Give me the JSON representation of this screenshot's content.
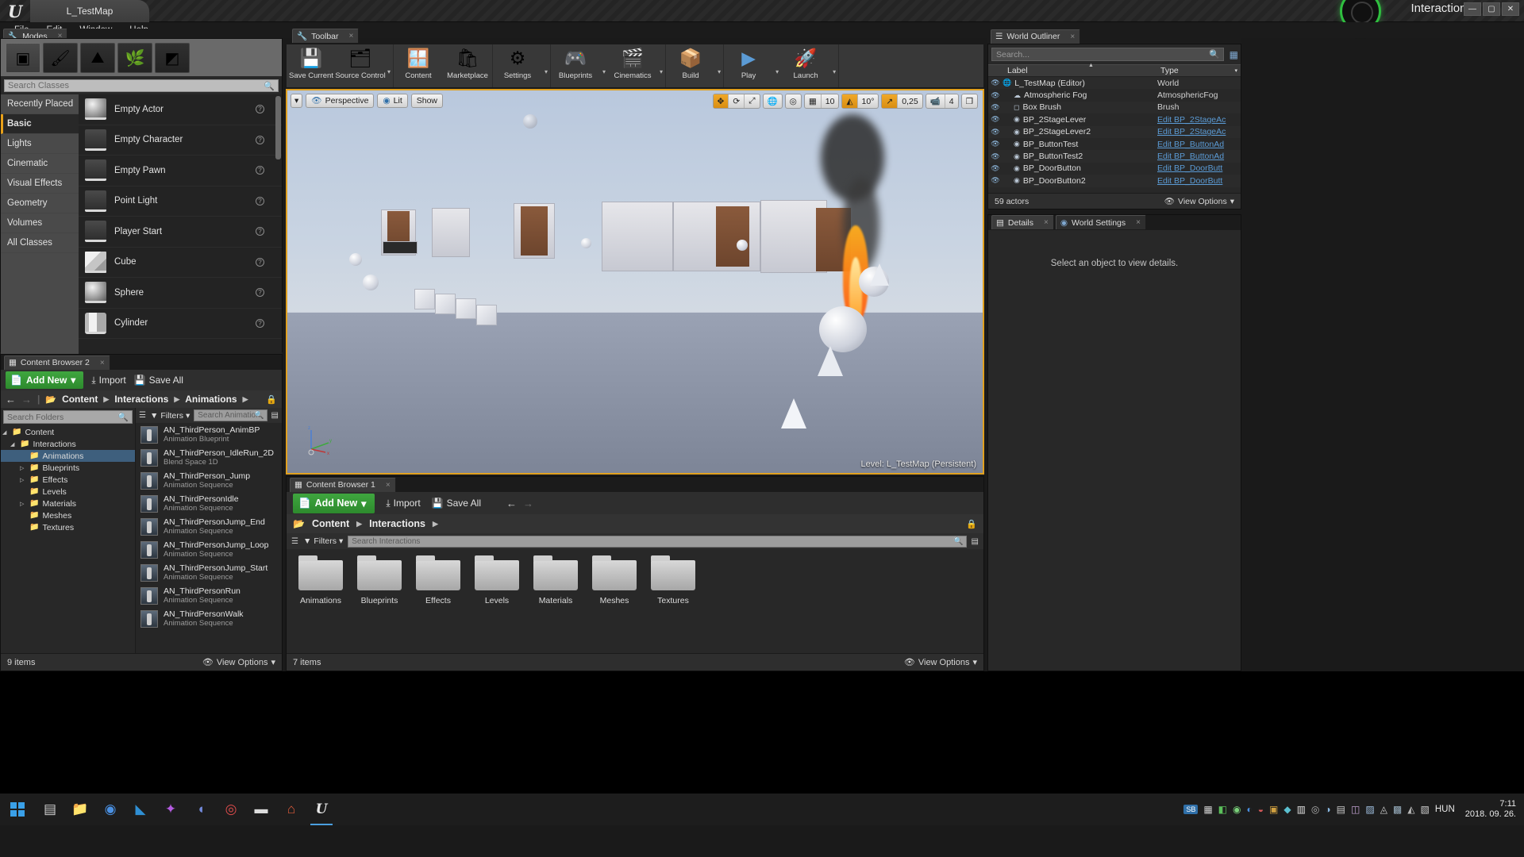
{
  "window": {
    "map_tab": "L_TestMap",
    "project_name": "Interactions",
    "minimize": "—",
    "maximize": "▢",
    "close": "✕"
  },
  "menu": {
    "items": [
      "File",
      "Edit",
      "Window",
      "Help"
    ]
  },
  "modes": {
    "tab": "Modes",
    "tab_close": "×",
    "mode_buttons": [
      {
        "name": "place-mode",
        "glyph": "▣"
      },
      {
        "name": "paint-mode",
        "glyph": "🖌"
      },
      {
        "name": "landscape-mode",
        "glyph": "⛰"
      },
      {
        "name": "foliage-mode",
        "glyph": "🌿"
      },
      {
        "name": "geometry-editing-mode",
        "glyph": "◩"
      }
    ],
    "search_placeholder": "Search Classes",
    "categories": [
      "Recently Placed",
      "Basic",
      "Lights",
      "Cinematic",
      "Visual Effects",
      "Geometry",
      "Volumes",
      "All Classes"
    ],
    "active_category": "Basic",
    "assets": [
      {
        "name": "Empty Actor",
        "thumb": "sphere"
      },
      {
        "name": "Empty Character",
        "thumb": "dark"
      },
      {
        "name": "Empty Pawn",
        "thumb": "dark"
      },
      {
        "name": "Point Light",
        "thumb": "dark"
      },
      {
        "name": "Player Start",
        "thumb": "dark"
      },
      {
        "name": "Cube",
        "thumb": "cube"
      },
      {
        "name": "Sphere",
        "thumb": "sphere"
      },
      {
        "name": "Cylinder",
        "thumb": "cyl"
      }
    ],
    "help_glyph": "?"
  },
  "toolbar": {
    "tab": "Toolbar",
    "tab_close": "×",
    "items": [
      {
        "label": "Save Current",
        "icon": "save-icon",
        "glyph": "💾",
        "caret": false
      },
      {
        "label": "Source Control",
        "icon": "source-control-icon",
        "glyph": "🗂",
        "caret": true
      },
      {
        "label": "Content",
        "icon": "content-icon",
        "glyph": "🪟",
        "caret": false
      },
      {
        "label": "Marketplace",
        "icon": "marketplace-icon",
        "glyph": "🛍",
        "caret": false
      },
      {
        "label": "Settings",
        "icon": "settings-icon",
        "glyph": "⚙",
        "caret": true
      },
      {
        "label": "Blueprints",
        "icon": "blueprints-icon",
        "glyph": "🎮",
        "caret": true
      },
      {
        "label": "Cinematics",
        "icon": "cinematics-icon",
        "glyph": "🎬",
        "caret": true
      },
      {
        "label": "Build",
        "icon": "build-icon",
        "glyph": "📦",
        "caret": true
      },
      {
        "label": "Play",
        "icon": "play-icon",
        "glyph": "▶",
        "caret": true
      },
      {
        "label": "Launch",
        "icon": "launch-icon",
        "glyph": "🚀",
        "caret": true
      }
    ]
  },
  "viewport": {
    "menu_caret": "▾",
    "perspective": "Perspective",
    "perspective_icon": "eye-icon",
    "lit": "Lit",
    "show": "Show",
    "transform_tools": [
      "✥",
      "⟳",
      "⤢"
    ],
    "coord_icon": "🌐",
    "surface_snap_icon": "◎",
    "grid_snap_icon": "▦",
    "grid_value": "10",
    "angle_snap_icon": "◭",
    "angle_value": "10°",
    "scale_snap_icon": "↗",
    "scale_value": "0,25",
    "camera_icon": "📹",
    "camera_speed": "4",
    "maximize_icon": "❐",
    "level_label": "Level:  L_TestMap (Persistent)",
    "axis_labels": [
      "z",
      "y",
      "x"
    ]
  },
  "content_browser_2": {
    "tab": "Content Browser 2",
    "tab_close": "×",
    "add_new": "Add New",
    "add_new_caret": "▾",
    "import": "Import",
    "save_all": "Save All",
    "breadcrumb": [
      "Content",
      "Interactions",
      "Animations"
    ],
    "breadcrumb_sep": "▶",
    "back_arrow": "←",
    "forward_arrow": "→",
    "lock_icon": "🔒",
    "folder_search_placeholder": "Search Folders",
    "tree": [
      {
        "label": "Content",
        "depth": 0,
        "arrow": "◢",
        "selected": false
      },
      {
        "label": "Interactions",
        "depth": 1,
        "arrow": "◢",
        "selected": false
      },
      {
        "label": "Animations",
        "depth": 2,
        "arrow": "",
        "selected": true
      },
      {
        "label": "Blueprints",
        "depth": 2,
        "arrow": "▷",
        "selected": false
      },
      {
        "label": "Effects",
        "depth": 2,
        "arrow": "▷",
        "selected": false
      },
      {
        "label": "Levels",
        "depth": 2,
        "arrow": "",
        "selected": false
      },
      {
        "label": "Materials",
        "depth": 2,
        "arrow": "▷",
        "selected": false
      },
      {
        "label": "Meshes",
        "depth": 2,
        "arrow": "",
        "selected": false
      },
      {
        "label": "Textures",
        "depth": 2,
        "arrow": "",
        "selected": false
      }
    ],
    "filters_label": "Filters",
    "filters_caret": "▾",
    "asset_search_placeholder": "Search Animation",
    "assets": [
      {
        "name": "AN_ThirdPerson_AnimBP",
        "type": "Animation Blueprint"
      },
      {
        "name": "AN_ThirdPerson_IdleRun_2D",
        "type": "Blend Space 1D"
      },
      {
        "name": "AN_ThirdPerson_Jump",
        "type": "Animation Sequence"
      },
      {
        "name": "AN_ThirdPersonIdle",
        "type": "Animation Sequence"
      },
      {
        "name": "AN_ThirdPersonJump_End",
        "type": "Animation Sequence"
      },
      {
        "name": "AN_ThirdPersonJump_Loop",
        "type": "Animation Sequence"
      },
      {
        "name": "AN_ThirdPersonJump_Start",
        "type": "Animation Sequence"
      },
      {
        "name": "AN_ThirdPersonRun",
        "type": "Animation Sequence"
      },
      {
        "name": "AN_ThirdPersonWalk",
        "type": "Animation Sequence"
      }
    ],
    "item_count": "9 items",
    "view_options": "View Options",
    "view_options_icon": "👁",
    "view_options_caret": "▾"
  },
  "content_browser_1": {
    "tab": "Content Browser 1",
    "tab_close": "×",
    "add_new": "Add New",
    "add_new_caret": "▾",
    "import": "Import",
    "save_all": "Save All",
    "back_arrow": "←",
    "forward_arrow": "→",
    "breadcrumb": [
      "Content",
      "Interactions"
    ],
    "breadcrumb_sep": "▶",
    "lock_icon": "🔒",
    "filters_label": "Filters",
    "filters_caret": "▾",
    "search_placeholder": "Search Interactions",
    "folders": [
      "Animations",
      "Blueprints",
      "Effects",
      "Levels",
      "Materials",
      "Meshes",
      "Textures"
    ],
    "item_count": "7 items",
    "view_options": "View Options",
    "view_options_icon": "👁",
    "view_options_caret": "▾"
  },
  "world_outliner": {
    "tab": "World Outliner",
    "tab_close": "×",
    "search_placeholder": "Search...",
    "search_icon": "🔍",
    "settings_icon": "▦",
    "col_label": "Label",
    "col_type": "Type",
    "sort_arrow": "▲",
    "col_caret": "▾",
    "rows": [
      {
        "label": "L_TestMap (Editor)",
        "type": "World",
        "depth": 0,
        "icon": "🌐",
        "link": false
      },
      {
        "label": "Atmospheric Fog",
        "type": "AtmosphericFog",
        "depth": 1,
        "icon": "☁",
        "link": false
      },
      {
        "label": "Box Brush",
        "type": "Brush",
        "depth": 1,
        "icon": "◻",
        "link": false
      },
      {
        "label": "BP_2StageLever",
        "type": "Edit BP_2StageAc",
        "depth": 1,
        "icon": "◉",
        "link": true
      },
      {
        "label": "BP_2StageLever2",
        "type": "Edit BP_2StageAc",
        "depth": 1,
        "icon": "◉",
        "link": true
      },
      {
        "label": "BP_ButtonTest",
        "type": "Edit BP_ButtonAd",
        "depth": 1,
        "icon": "◉",
        "link": true
      },
      {
        "label": "BP_ButtonTest2",
        "type": "Edit BP_ButtonAd",
        "depth": 1,
        "icon": "◉",
        "link": true
      },
      {
        "label": "BP_DoorButton",
        "type": "Edit BP_DoorButt",
        "depth": 1,
        "icon": "◉",
        "link": true
      },
      {
        "label": "BP_DoorButton2",
        "type": "Edit BP_DoorButt",
        "depth": 1,
        "icon": "◉",
        "link": true
      }
    ],
    "actor_count": "59 actors",
    "view_options": "View Options",
    "view_options_icon": "👁",
    "view_options_caret": "▾"
  },
  "details": {
    "tab_details": "Details",
    "tab_world_settings": "World Settings",
    "tab_close": "×",
    "empty_message": "Select an object to view details."
  },
  "taskbar": {
    "start_icon": "start-icon",
    "apps": [
      {
        "name": "taskview-icon",
        "glyph": "▤",
        "color": "#cfcfcf",
        "active": false
      },
      {
        "name": "file-explorer-icon",
        "glyph": "📁",
        "color": "#e8b64c",
        "active": false
      },
      {
        "name": "chrome-icon",
        "glyph": "◉",
        "color": "#4a90e2",
        "active": false
      },
      {
        "name": "vscode-icon",
        "glyph": "◣",
        "color": "#2f8fd4",
        "active": false
      },
      {
        "name": "visual-studio-icon",
        "glyph": "✦",
        "color": "#b45be0",
        "active": false
      },
      {
        "name": "discord-icon",
        "glyph": "◖",
        "color": "#7289da",
        "active": false
      },
      {
        "name": "opera-icon",
        "glyph": "◎",
        "color": "#d84a4a",
        "active": false
      },
      {
        "name": "epic-games-icon",
        "glyph": "▬",
        "color": "#dcdcdc",
        "active": false
      },
      {
        "name": "home-icon",
        "glyph": "⌂",
        "color": "#e05c3a",
        "active": false
      },
      {
        "name": "unreal-engine-icon",
        "glyph": "U",
        "color": "#e8e8e8",
        "active": true
      }
    ],
    "tray_badge": "SB",
    "tray_icons": [
      "▦",
      "◧",
      "◉",
      "◐",
      "◒",
      "▣",
      "◆",
      "▥",
      "◎",
      "◑",
      "▤",
      "◫",
      "▨",
      "◬",
      "▩",
      "◭",
      "▧",
      "◮"
    ],
    "language": "HUN",
    "time": "7:11",
    "date": "2018. 09. 26."
  }
}
